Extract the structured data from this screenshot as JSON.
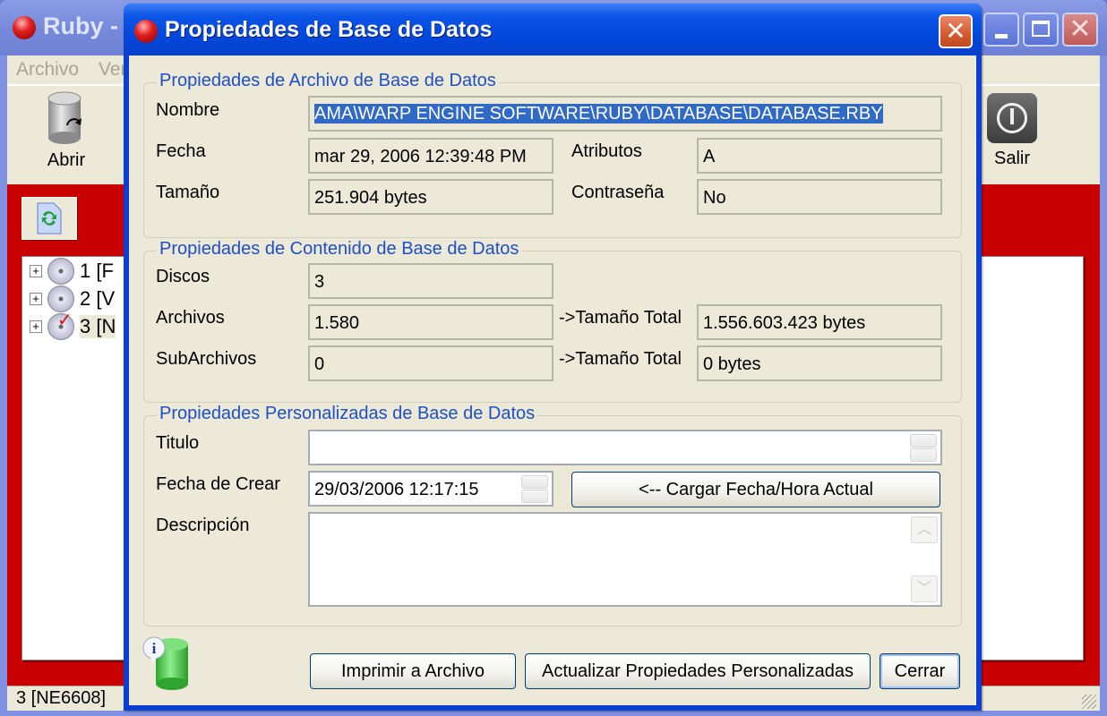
{
  "main_window": {
    "title": "Ruby - ",
    "menu": [
      "Archivo",
      "Ver"
    ],
    "toolbar": {
      "open_label": "Abrir",
      "exit_label": "Salir"
    },
    "tree": [
      {
        "label": "1 [F",
        "checked": false,
        "selected": false
      },
      {
        "label": "2 [V",
        "checked": false,
        "selected": false
      },
      {
        "label": "3 [N",
        "checked": true,
        "selected": true
      }
    ],
    "status_text": "3 [NE6608]",
    "accent_color": "#c80000"
  },
  "dialog": {
    "title": "Propiedades de Base de Datos",
    "file_group": {
      "title": "Propiedades de Archivo de Base de Datos",
      "name_label": "Nombre",
      "name_value": "AMA\\WARP ENGINE SOFTWARE\\RUBY\\DATABASE\\DATABASE.RBY",
      "date_label": "Fecha",
      "date_value": "mar 29, 2006 12:39:48 PM",
      "size_label": "Tamaño",
      "size_value": "251.904 bytes",
      "attributes_label": "Atributos",
      "attributes_value": "A",
      "password_label": "Contraseña",
      "password_value": "No"
    },
    "content_group": {
      "title": "Propiedades de Contenido de Base de Datos",
      "discs_label": "Discos",
      "discs_value": "3",
      "files_label": "Archivos",
      "files_value": "1.580",
      "subfiles_label": "SubArchivos",
      "subfiles_value": "0",
      "files_total_label": "->Tamaño Total",
      "files_total_value": "1.556.603.423 bytes",
      "subfiles_total_label": "->Tamaño Total",
      "subfiles_total_value": "0 bytes"
    },
    "custom_group": {
      "title": "Propiedades Personalizadas de Base de Datos",
      "title_label": "Titulo",
      "title_value": "",
      "created_label": "Fecha de Crear",
      "created_value": "29/03/2006 12:17:15",
      "load_now_button": "<-- Cargar Fecha/Hora Actual",
      "description_label": "Descripción",
      "description_value": ""
    },
    "buttons": {
      "print": "Imprimir a Archivo",
      "update": "Actualizar Propiedades Personalizadas",
      "close": "Cerrar"
    }
  }
}
